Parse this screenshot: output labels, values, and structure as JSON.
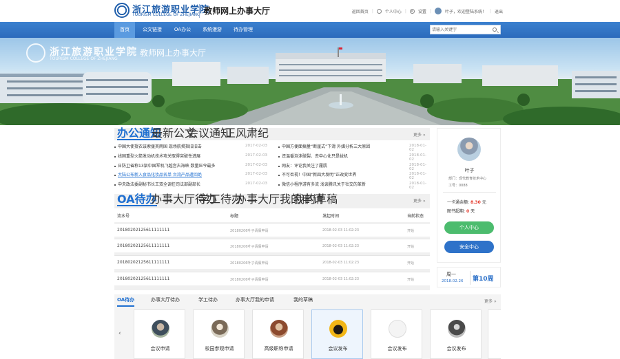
{
  "header": {
    "logo_cn": "浙江旅游职业学院",
    "logo_en": "TOURISM COLLEGE OF ZHEJIANG",
    "title": "教师网上办事大厅",
    "links": {
      "home": "返回首页",
      "personal": "个人中心",
      "settings": "设置",
      "welcome": "叶子，欢迎登陆系统！",
      "logout": "退出"
    }
  },
  "nav": {
    "items": [
      "首页",
      "公文链接",
      "OA办公",
      "系统漫游",
      "待办管理"
    ],
    "active": 0
  },
  "search": {
    "placeholder": "请输入关键字"
  },
  "banner": {
    "logo_cn": "浙江旅游职业学院",
    "logo_en": "TOURISM COLLEGE OF ZHEJIANG",
    "title": "教师网上办事大厅"
  },
  "notice": {
    "tabs": [
      "办公通知",
      "最新公文",
      "会议通知",
      "正风肃纪"
    ],
    "more": "更多",
    "left": [
      {
        "title": "中国大使授衣该索援英雨国 现场航揭指旧旧击",
        "date": "2017-02-03"
      },
      {
        "title": "线固重型火箭发动机技术攻关取得突破性进展",
        "date": "2017-02-03"
      },
      {
        "title": "日防卫省称13架中国军机飞越宫古海峡 数量压今最多",
        "date": "2017-02-03"
      },
      {
        "title": "大陆公布新入食品化妆品名单 台湾产品遭回绝",
        "date": "2017-02-03",
        "link": true
      },
      {
        "title": "中央政法委副秘书长王双全调任司法部副部长",
        "date": "2017-02-03"
      }
    ],
    "right": [
      {
        "title": "中国方便面搞量“断崖式”下滑 外媒分析三大原因",
        "date": "2018-01-02"
      },
      {
        "title": "还温番泡沫破裂、去中心化只是拢机",
        "date": "2018-01-02"
      },
      {
        "title": "网友：评论我关注了履肌",
        "date": "2018-01-02"
      },
      {
        "title": "不可否视！中国“新四大发明”正改变世界",
        "date": "2018-01-02"
      },
      {
        "title": "微信小程序游有多流 浅谈腾讯关于社交的革新",
        "date": "2018-01-02"
      }
    ]
  },
  "oa": {
    "tabs": [
      "OA待办",
      "办事大厅待办",
      "学工待办",
      "办事大厅我的申请",
      "我的草稿"
    ],
    "more": "更多",
    "columns": [
      "流水号",
      "标题",
      "发起时间",
      "当前状态"
    ],
    "rows": [
      {
        "id": "20180202125611111111",
        "title": "20180206叶子请假申请",
        "time": "2018-02-03 11:02:23",
        "status": "开始"
      },
      {
        "id": "20180202125611111111",
        "title": "20180206叶子请假申请",
        "time": "2018-02-03 11:02:23",
        "status": "开始"
      },
      {
        "id": "20180202125611111111",
        "title": "20180206叶子请假申请",
        "time": "2018-02-03 11:02:23",
        "status": "开始"
      },
      {
        "id": "20180202125611111111",
        "title": "20180206叶子请假申请",
        "time": "2018-02-03 11:02:23",
        "status": "开始"
      }
    ]
  },
  "profile": {
    "name": "叶子",
    "dept": "部门：现代教育技术中心",
    "job_no": "工号：0088",
    "card_label": "一卡通余额:",
    "card_value": "8.30",
    "card_unit": "元",
    "book_label": "图书超期:",
    "book_value": "0",
    "book_unit": "天",
    "btn_personal": "个人中心",
    "btn_security": "安全中心"
  },
  "week": {
    "day": "周一",
    "date": "2018.02.26",
    "week_no": "第10周"
  },
  "apps": {
    "tabs": [
      "OA待办",
      "办事大厅待办",
      "学工待办",
      "办事大厅我的申请",
      "我的草稿"
    ],
    "more": "更多",
    "cards": [
      {
        "label": "会议申请"
      },
      {
        "label": "校园参观申请"
      },
      {
        "label": "高级职称申请"
      },
      {
        "label": "会议发布"
      },
      {
        "label": "会议发布"
      },
      {
        "label": "会议发布"
      }
    ]
  },
  "colors": {
    "primary": "#2b6bbc",
    "link": "#1f6fd0",
    "green": "#4cbc6e",
    "red": "#e4392b"
  }
}
